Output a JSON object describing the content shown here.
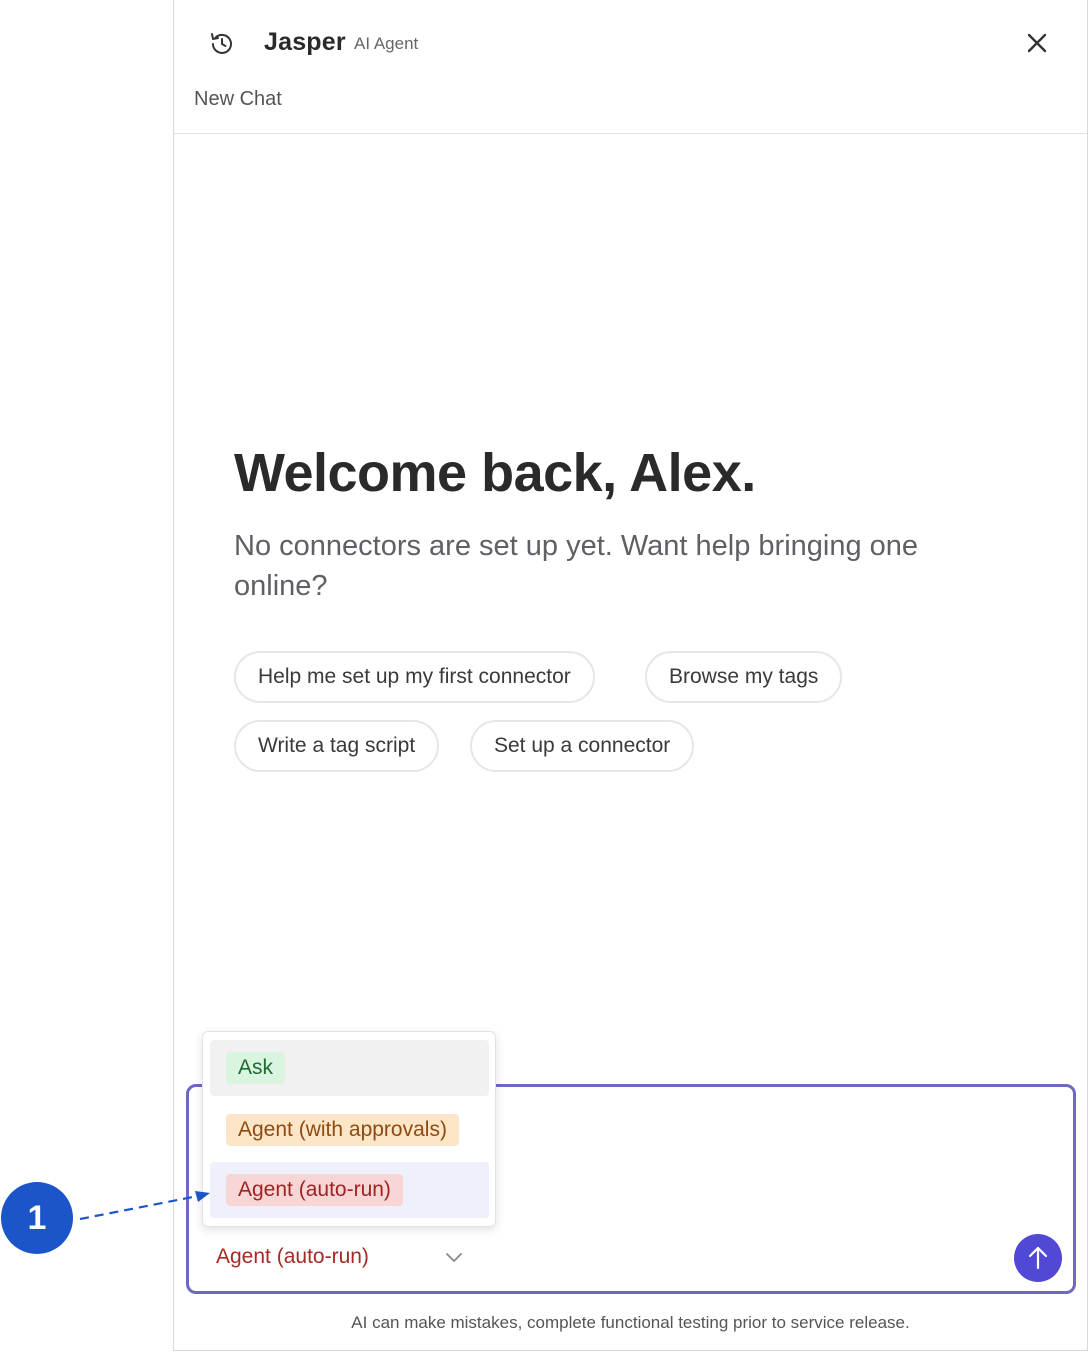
{
  "header": {
    "history_icon": "history-icon",
    "app_name": "Jasper",
    "badge": "AI Agent",
    "close_icon": "close-icon",
    "chat_title": "New Chat"
  },
  "welcome": {
    "heading": "Welcome back, Alex.",
    "subtitle": "No connectors are set up yet. Want help bringing one online?"
  },
  "suggestions": [
    "Help me set up my first connector",
    "Browse my tags",
    "Write a tag script",
    "Set up a connector"
  ],
  "mode_menu": {
    "options": [
      "Ask",
      "Agent (with approvals)",
      "Agent (auto-run)"
    ],
    "selected": "Agent (auto-run)",
    "chevron_icon": "chevron-down-icon"
  },
  "composer": {
    "send_icon": "arrow-up-icon",
    "accent_color": "#5148d6"
  },
  "disclaimer": "AI can make mistakes, complete functional testing prior to service release.",
  "annotation": {
    "step_number": "1"
  }
}
